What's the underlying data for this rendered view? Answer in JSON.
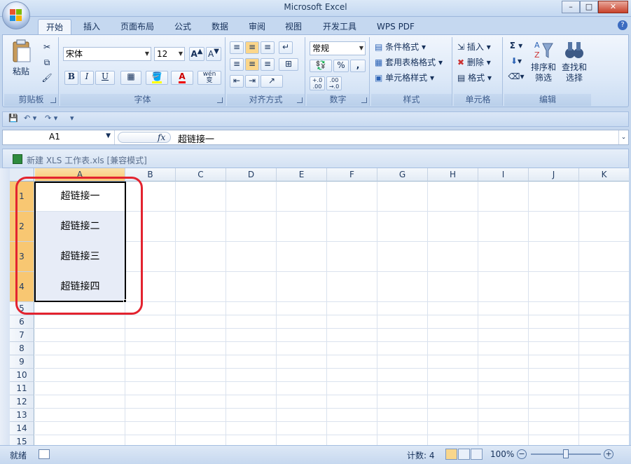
{
  "window": {
    "title": "Microsoft Excel",
    "minimize": "–",
    "maximize": "□",
    "close": "✕"
  },
  "tabs": [
    "开始",
    "插入",
    "页面布局",
    "公式",
    "数据",
    "审阅",
    "视图",
    "开发工具",
    "WPS PDF"
  ],
  "ribbon": {
    "clipboard": {
      "label": "剪贴板",
      "paste": "粘贴"
    },
    "font": {
      "label": "字体",
      "name": "宋体",
      "size": "12",
      "bold": "B",
      "italic": "I",
      "underline": "U",
      "font_color": "A",
      "phonetic": "wén\n变"
    },
    "alignment": {
      "label": "对齐方式"
    },
    "number": {
      "label": "数字",
      "format": "常规",
      "percent": "%",
      "comma": ",",
      "inc_decimal": "+.0\n.00",
      "dec_decimal": ".00\n→.0"
    },
    "styles": {
      "label": "样式",
      "conditional": "条件格式",
      "table_format": "套用表格格式",
      "cell_styles": "单元格样式"
    },
    "cells": {
      "label": "单元格",
      "insert": "插入",
      "delete": "删除",
      "format": "格式"
    },
    "editing": {
      "label": "编辑",
      "sum": "Σ",
      "sort_filter": "排序和\n筛选",
      "find_select": "查找和\n选择"
    }
  },
  "formula_bar": {
    "cell_ref": "A1",
    "fx": "fx",
    "value": "超链接一"
  },
  "workbook": {
    "title": "新建 XLS 工作表.xls  [兼容模式]"
  },
  "columns": [
    "A",
    "B",
    "C",
    "D",
    "E",
    "F",
    "G",
    "H",
    "I",
    "J",
    "K"
  ],
  "rows": [
    "1",
    "2",
    "3",
    "4",
    "5",
    "6",
    "7",
    "8",
    "9",
    "10",
    "11",
    "12",
    "13",
    "14",
    "15"
  ],
  "cells": [
    "超链接一",
    "超链接二",
    "超链接三",
    "超链接四"
  ],
  "status": {
    "ready": "就绪",
    "count": "计数: 4",
    "zoom": "100%",
    "zoom_out": "−",
    "zoom_in": "+"
  },
  "colors": {
    "annotation": "#e3232f",
    "header_selected": "#f8c772",
    "ribbon_bg": "#dde9f8"
  }
}
